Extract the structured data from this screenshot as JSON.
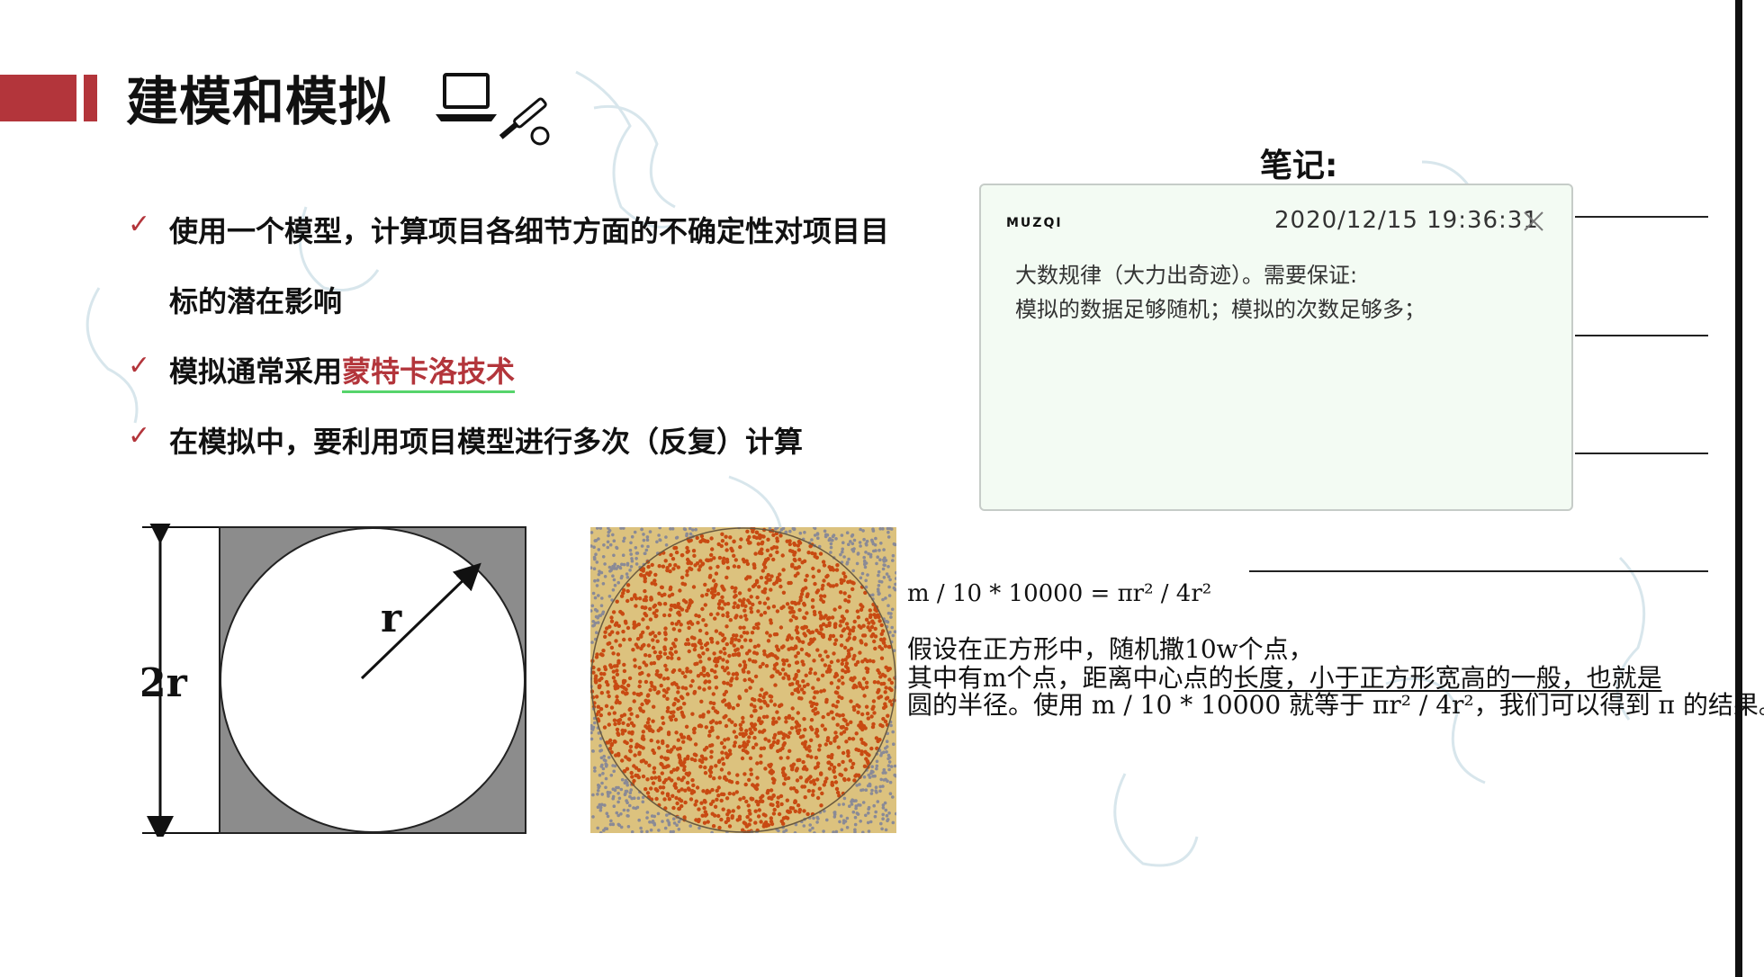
{
  "header": {
    "title": "建模和模拟"
  },
  "bullets": {
    "check_glyph": "✓",
    "item1": {
      "line1": "使用一个模型，计算项目各细节方面的不确定性对项目目",
      "line2": "标的潜在影响"
    },
    "item2": {
      "prefix": "模拟通常采用",
      "highlight": "蒙特卡洛技术"
    },
    "item3": "在模拟中，要利用项目模型进行多次（反复）计算"
  },
  "figures": {
    "square_circle": {
      "side_label": "2r",
      "radius_label": "r"
    },
    "monte_carlo": {
      "description": "random dots in square with inscribed circle"
    }
  },
  "notes": {
    "heading": "笔记:",
    "brand": "MUZQI",
    "timestamp": "2020/12/15 19:36:31",
    "line1": "大数规律（大力出奇迹）。需要保证:",
    "line2": "模拟的数据足够随机；模拟的次数足够多；"
  },
  "explanation": {
    "formula": "m / 10 * 10000 = πr² / 4r²",
    "line1": "假设在正方形中，随机撒10w个点，",
    "line2_prefix": "其中有m个点，距离中心点的",
    "line2_underlined": "长度，小于正方形宽高的一般，也就是",
    "line3": "圆的半径。使用 m / 10 * 10000 就等于 πr² / 4r²，我们可以得到 π 的结果。"
  },
  "colors": {
    "accent": "#b3353b",
    "highlight_underline": "#56d46b",
    "note_bg": "#f3fbf3",
    "inside_dot": "#c84a12",
    "outside_dot": "#8a8a96",
    "sand": "#dcc27e"
  },
  "icons": {
    "header_icon": "computer-tools-icon",
    "close": "close-icon"
  }
}
